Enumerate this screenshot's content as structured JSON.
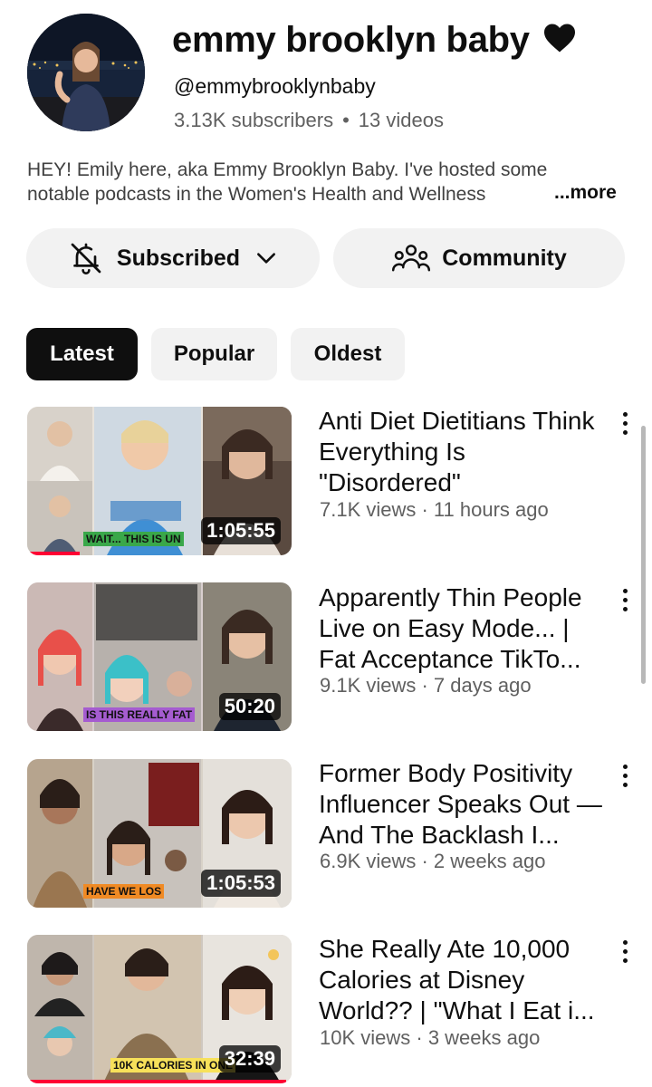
{
  "channel": {
    "name": "emmy brooklyn baby",
    "handle": "@emmybrooklynbaby",
    "subscribers": "3.13K subscribers",
    "videos_count": "13 videos",
    "description_line1": "HEY! Emily here, aka Emmy Brooklyn Baby. I've hosted some",
    "description_line2": "notable podcasts in the Women's Health and Wellness",
    "more_label": "...more"
  },
  "actions": {
    "subscribed_label": "Subscribed",
    "community_label": "Community"
  },
  "filters": [
    {
      "label": "Latest",
      "selected": true
    },
    {
      "label": "Popular",
      "selected": false
    },
    {
      "label": "Oldest",
      "selected": false
    }
  ],
  "videos": [
    {
      "title": "Anti Diet Dietitians Think Everything Is \"Disordered\"",
      "meta": "7.1K views · 11 hours ago",
      "duration": "1:05:55",
      "overlay_caption": "WAIT... THIS IS UN",
      "overlay_color": "#3aa84a",
      "watched_fraction": 0.2
    },
    {
      "title": "Apparently Thin People Live on Easy Mode... | Fat Acceptance TikTo...",
      "meta": "9.1K views · 7 days ago",
      "duration": "50:20",
      "overlay_caption": "IS THIS REALLY FAT",
      "overlay_color": "#a55cd0",
      "watched_fraction": 0
    },
    {
      "title": "Former Body Positivity Influencer Speaks Out — And The Backlash I...",
      "meta": "6.9K views · 2 weeks ago",
      "duration": "1:05:53",
      "overlay_caption": "HAVE WE LOS",
      "overlay_color": "#f08a24",
      "watched_fraction": 0
    },
    {
      "title": "She Really Ate 10,000 Calories at Disney World?? | \"What I Eat i...",
      "meta": "10K views · 3 weeks ago",
      "duration": "32:39",
      "overlay_caption": "10K CALORIES IN ONE",
      "overlay_color": "#f7e15a",
      "watched_fraction": 0.98
    }
  ],
  "colors": {
    "chip_active_bg": "#0f0f0f",
    "chip_bg": "#f2f2f2",
    "meta_gray": "#606060",
    "progress_red": "#ff0033"
  }
}
